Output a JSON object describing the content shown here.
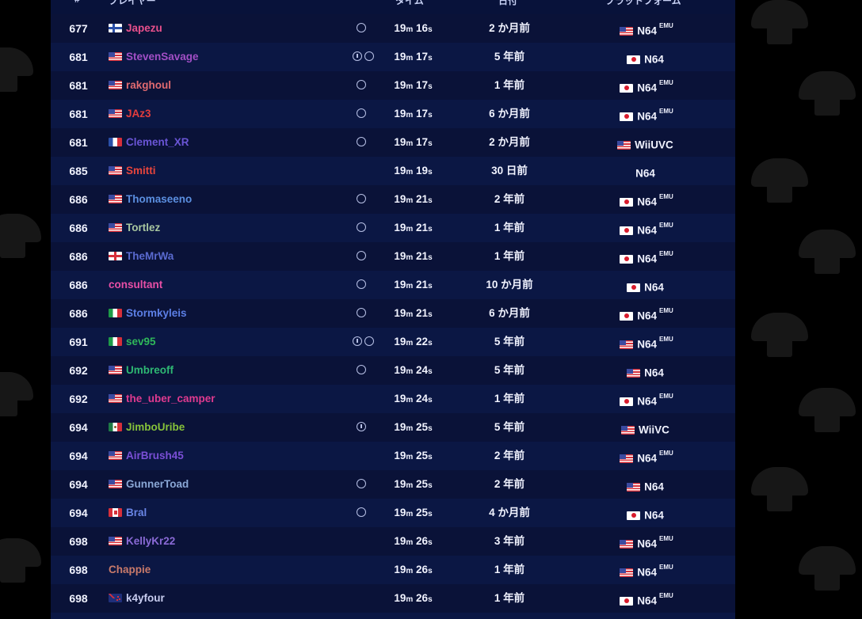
{
  "colors": {
    "board_bg": "#0b1744",
    "row_alt": "#0a1238",
    "page_bg": "#000000"
  },
  "header": {
    "cols": [
      "#",
      "プレイヤー",
      "タイム",
      "日付",
      "プラットフォーム"
    ]
  },
  "rows": [
    {
      "rank": "677",
      "flag": "fi",
      "name": "Japezu",
      "color": "#e8508c",
      "icons": [
        "comment"
      ],
      "time_m": "19",
      "time_s": "16",
      "date": "2 か月前",
      "pflag": "us",
      "platform": "N64",
      "emu": "EMU"
    },
    {
      "rank": "681",
      "flag": "us",
      "name": "StevenSavage",
      "color": "#a24fc6",
      "icons": [
        "info",
        "comment"
      ],
      "time_m": "19",
      "time_s": "17",
      "date": "5 年前",
      "pflag": "jp",
      "platform": "N64",
      "emu": ""
    },
    {
      "rank": "681",
      "flag": "us",
      "name": "rakghoul",
      "color": "#e06a70",
      "icons": [
        "comment"
      ],
      "time_m": "19",
      "time_s": "17",
      "date": "1 年前",
      "pflag": "jp",
      "platform": "N64",
      "emu": "EMU"
    },
    {
      "rank": "681",
      "flag": "us",
      "name": "JAz3",
      "color": "#e23d3d",
      "icons": [
        "comment"
      ],
      "time_m": "19",
      "time_s": "17",
      "date": "6 か月前",
      "pflag": "jp",
      "platform": "N64",
      "emu": "EMU"
    },
    {
      "rank": "681",
      "flag": "fr",
      "name": "Clement_XR",
      "color": "#6a55d6",
      "icons": [
        "comment"
      ],
      "time_m": "19",
      "time_s": "17",
      "date": "2 か月前",
      "pflag": "us",
      "platform": "WiiUVC",
      "emu": ""
    },
    {
      "rank": "685",
      "flag": "us",
      "name": "Smitti",
      "color": "#e8453c",
      "icons": [],
      "time_m": "19",
      "time_s": "19",
      "date": "30 日前",
      "pflag": "none",
      "platform": "N64",
      "emu": ""
    },
    {
      "rank": "686",
      "flag": "us",
      "name": "Thomaseeno",
      "color": "#5b8fe0",
      "icons": [
        "comment"
      ],
      "time_m": "19",
      "time_s": "21",
      "date": "2 年前",
      "pflag": "jp",
      "platform": "N64",
      "emu": "EMU"
    },
    {
      "rank": "686",
      "flag": "us",
      "name": "Tortlez",
      "color": "#a9c7a0",
      "icons": [
        "comment"
      ],
      "time_m": "19",
      "time_s": "21",
      "date": "1 年前",
      "pflag": "jp",
      "platform": "N64",
      "emu": "EMU"
    },
    {
      "rank": "686",
      "flag": "en",
      "name": "TheMrWa",
      "color": "#5a6ad0",
      "icons": [
        "comment"
      ],
      "time_m": "19",
      "time_s": "21",
      "date": "1 年前",
      "pflag": "jp",
      "platform": "N64",
      "emu": "EMU"
    },
    {
      "rank": "686",
      "flag": "none",
      "name": "consultant",
      "color": "#e84fa6",
      "icons": [
        "comment"
      ],
      "time_m": "19",
      "time_s": "21",
      "date": "10 か月前",
      "pflag": "jp",
      "platform": "N64",
      "emu": ""
    },
    {
      "rank": "686",
      "flag": "it",
      "name": "Stormkyleis",
      "color": "#5c7fe6",
      "icons": [
        "comment"
      ],
      "time_m": "19",
      "time_s": "21",
      "date": "6 か月前",
      "pflag": "jp",
      "platform": "N64",
      "emu": "EMU"
    },
    {
      "rank": "691",
      "flag": "it",
      "name": "sev95",
      "color": "#2fb85a",
      "icons": [
        "info",
        "comment"
      ],
      "time_m": "19",
      "time_s": "22",
      "date": "5 年前",
      "pflag": "us",
      "platform": "N64",
      "emu": "EMU"
    },
    {
      "rank": "692",
      "flag": "us",
      "name": "Umbreoff",
      "color": "#2eb873",
      "icons": [
        "comment"
      ],
      "time_m": "19",
      "time_s": "24",
      "date": "5 年前",
      "pflag": "us",
      "platform": "N64",
      "emu": ""
    },
    {
      "rank": "692",
      "flag": "us",
      "name": "the_uber_camper",
      "color": "#e03a8f",
      "icons": [],
      "time_m": "19",
      "time_s": "24",
      "date": "1 年前",
      "pflag": "jp",
      "platform": "N64",
      "emu": "EMU"
    },
    {
      "rank": "694",
      "flag": "mx",
      "name": "JimboUribe",
      "color": "#86c23a",
      "icons": [
        "info"
      ],
      "time_m": "19",
      "time_s": "25",
      "date": "5 年前",
      "pflag": "us",
      "platform": "WiiVC",
      "emu": ""
    },
    {
      "rank": "694",
      "flag": "us",
      "name": "AirBrush45",
      "color": "#7a4fd6",
      "icons": [],
      "time_m": "19",
      "time_s": "25",
      "date": "2 年前",
      "pflag": "us",
      "platform": "N64",
      "emu": "EMU"
    },
    {
      "rank": "694",
      "flag": "us",
      "name": "GunnerToad",
      "color": "#8aa7d6",
      "icons": [
        "comment"
      ],
      "time_m": "19",
      "time_s": "25",
      "date": "2 年前",
      "pflag": "us",
      "platform": "N64",
      "emu": ""
    },
    {
      "rank": "694",
      "flag": "ca",
      "name": "Bral",
      "color": "#6a86e6",
      "icons": [
        "comment"
      ],
      "time_m": "19",
      "time_s": "25",
      "date": "4 か月前",
      "pflag": "jp",
      "platform": "N64",
      "emu": ""
    },
    {
      "rank": "698",
      "flag": "us",
      "name": "KellyKr22",
      "color": "#8a6ad6",
      "icons": [],
      "time_m": "19",
      "time_s": "26",
      "date": "3 年前",
      "pflag": "us",
      "platform": "N64",
      "emu": "EMU"
    },
    {
      "rank": "698",
      "flag": "none",
      "name": "Chappie",
      "color": "#c97a6a",
      "icons": [],
      "time_m": "19",
      "time_s": "26",
      "date": "1 年前",
      "pflag": "us",
      "platform": "N64",
      "emu": "EMU"
    },
    {
      "rank": "698",
      "flag": "nz",
      "name": "k4yfour",
      "color": "#c8cdf0",
      "icons": [],
      "time_m": "19",
      "time_s": "26",
      "date": "1 年前",
      "pflag": "jp",
      "platform": "N64",
      "emu": "EMU"
    }
  ]
}
